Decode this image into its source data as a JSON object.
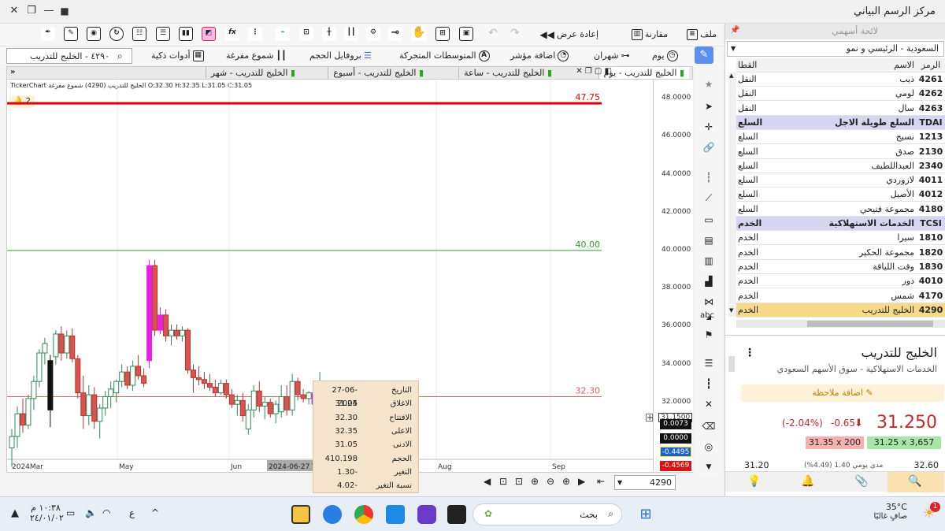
{
  "window": {
    "title": "مركز الرسم البياني"
  },
  "toolbar1": {
    "file": "ملف",
    "compare": "مقارنة",
    "replay": "إعادة عرض"
  },
  "toolbar2": {
    "search_value": "٤٢٩٠ - الخليج للتدريب",
    "smart_tools": "أدوات ذكية",
    "hollow_candles": "شموع مفرغة",
    "volume_profile": "بروفايل الحجم",
    "moving_averages": "المتوسطات المتحركة",
    "add_indicator": "اضافة مؤشر",
    "two_months": "شهران",
    "day": "يوم"
  },
  "tabs": [
    {
      "label": "الخليج للتدريب - يوم"
    },
    {
      "label": "الخليج للتدريب - ساعة"
    },
    {
      "label": "الخليج للتدريب - أسبوع"
    },
    {
      "label": "الخليج للتدريب - شهر"
    }
  ],
  "chart_header": {
    "source": "TickerChart",
    "symbol_info": "الخليج للتدريب (4290) شموع مفرغة",
    "ohlc": "O:32.30  H:32.35  L:31.05  C:31.05",
    "alerts_count": "2"
  },
  "chart_data": {
    "type": "candlestick",
    "yticks": [
      "48.0000",
      "46.0000",
      "44.0000",
      "42.0000",
      "40.0000",
      "38.0000",
      "36.0000",
      "34.0000",
      "32.0000",
      "30.0000"
    ],
    "xticks": [
      "2024Mar",
      "May",
      "Jun",
      "Aug",
      "Sep"
    ],
    "cursor_date": "2024-06-27 T",
    "levels": [
      {
        "label": "47.75",
        "value": 47.75,
        "color": "#e00000"
      },
      {
        "label": "40.00",
        "value": 40.0,
        "color": "#2ca02c"
      },
      {
        "label": "32.30",
        "value": 32.3,
        "color": "#e06060"
      }
    ],
    "last_price_label": "31.1500",
    "ylim": [
      29.0,
      49.0
    ],
    "candles": [
      {
        "o": 29.6,
        "h": 30.6,
        "l": 28.6,
        "c": 30.2,
        "col": "g"
      },
      {
        "o": 30.2,
        "h": 31.8,
        "l": 29.6,
        "c": 31.4,
        "col": "g"
      },
      {
        "o": 31.4,
        "h": 32.2,
        "l": 30.4,
        "c": 30.8,
        "col": "r"
      },
      {
        "o": 30.8,
        "h": 32.4,
        "l": 30.6,
        "c": 32.2,
        "col": "g"
      },
      {
        "o": 32.2,
        "h": 33.4,
        "l": 31.6,
        "c": 33.1,
        "col": "g"
      },
      {
        "o": 33.1,
        "h": 34.8,
        "l": 32.8,
        "c": 34.6,
        "col": "g"
      },
      {
        "o": 34.6,
        "h": 35.4,
        "l": 34.0,
        "c": 35.1,
        "col": "g"
      },
      {
        "o": 31.6,
        "h": 34.5,
        "l": 30.7,
        "c": 34.2,
        "col": "k"
      },
      {
        "o": 34.4,
        "h": 35.8,
        "l": 34.0,
        "c": 35.6,
        "col": "g"
      },
      {
        "o": 35.6,
        "h": 36.0,
        "l": 34.2,
        "c": 34.6,
        "col": "r"
      },
      {
        "o": 34.6,
        "h": 35.8,
        "l": 34.3,
        "c": 35.5,
        "col": "g"
      },
      {
        "o": 35.5,
        "h": 35.9,
        "l": 34.1,
        "c": 34.3,
        "col": "r"
      },
      {
        "o": 34.3,
        "h": 34.5,
        "l": 32.2,
        "c": 32.5,
        "col": "r"
      },
      {
        "o": 32.5,
        "h": 33.4,
        "l": 30.6,
        "c": 31.3,
        "col": "r"
      },
      {
        "o": 31.3,
        "h": 32.9,
        "l": 30.8,
        "c": 32.4,
        "col": "g"
      },
      {
        "o": 32.4,
        "h": 32.8,
        "l": 30.6,
        "c": 31.0,
        "col": "r"
      },
      {
        "o": 31.0,
        "h": 31.9,
        "l": 30.1,
        "c": 31.7,
        "col": "g"
      },
      {
        "o": 31.7,
        "h": 32.6,
        "l": 31.3,
        "c": 32.3,
        "col": "g"
      },
      {
        "o": 32.3,
        "h": 33.1,
        "l": 31.7,
        "c": 32.7,
        "col": "g"
      },
      {
        "o": 32.5,
        "h": 33.2,
        "l": 32.0,
        "c": 33.1,
        "col": "g"
      },
      {
        "o": 33.1,
        "h": 34.0,
        "l": 32.8,
        "c": 33.6,
        "col": "g"
      },
      {
        "o": 33.6,
        "h": 33.9,
        "l": 32.7,
        "c": 32.9,
        "col": "r"
      },
      {
        "o": 32.9,
        "h": 34.2,
        "l": 32.6,
        "c": 33.9,
        "col": "g"
      },
      {
        "o": 33.9,
        "h": 34.5,
        "l": 33.2,
        "c": 33.4,
        "col": "r"
      },
      {
        "o": 33.4,
        "h": 33.8,
        "l": 32.8,
        "c": 33.0,
        "col": "r"
      },
      {
        "o": 34.2,
        "h": 39.5,
        "l": 33.8,
        "c": 39.2,
        "col": "m"
      },
      {
        "o": 39.2,
        "h": 39.5,
        "l": 35.5,
        "c": 35.8,
        "col": "r"
      },
      {
        "o": 35.8,
        "h": 37.0,
        "l": 35.6,
        "c": 36.6,
        "col": "m"
      },
      {
        "o": 36.6,
        "h": 36.9,
        "l": 35.2,
        "c": 35.5,
        "col": "r"
      },
      {
        "o": 35.5,
        "h": 36.1,
        "l": 35.0,
        "c": 35.8,
        "col": "g"
      },
      {
        "o": 35.8,
        "h": 36.1,
        "l": 35.3,
        "c": 35.5,
        "col": "r"
      },
      {
        "o": 35.5,
        "h": 36.0,
        "l": 35.2,
        "c": 35.8,
        "col": "g"
      },
      {
        "o": 35.8,
        "h": 35.9,
        "l": 33.5,
        "c": 33.7,
        "col": "r"
      },
      {
        "o": 33.7,
        "h": 34.0,
        "l": 32.5,
        "c": 33.3,
        "col": "r"
      },
      {
        "o": 33.3,
        "h": 33.9,
        "l": 32.9,
        "c": 33.2,
        "col": "r"
      },
      {
        "o": 33.2,
        "h": 33.6,
        "l": 32.7,
        "c": 33.0,
        "col": "r"
      },
      {
        "o": 33.0,
        "h": 33.5,
        "l": 32.6,
        "c": 32.8,
        "col": "r"
      },
      {
        "o": 32.8,
        "h": 33.2,
        "l": 32.3,
        "c": 32.5,
        "col": "r"
      },
      {
        "o": 32.5,
        "h": 33.2,
        "l": 32.4,
        "c": 33.0,
        "col": "g"
      },
      {
        "o": 33.0,
        "h": 33.2,
        "l": 32.2,
        "c": 32.4,
        "col": "r"
      },
      {
        "o": 32.4,
        "h": 32.7,
        "l": 31.7,
        "c": 31.9,
        "col": "r"
      },
      {
        "o": 31.9,
        "h": 32.4,
        "l": 31.3,
        "c": 32.1,
        "col": "g"
      },
      {
        "o": 32.1,
        "h": 32.5,
        "l": 31.0,
        "c": 31.3,
        "col": "r"
      },
      {
        "o": 30.6,
        "h": 31.9,
        "l": 30.3,
        "c": 31.6,
        "col": "g"
      },
      {
        "o": 31.6,
        "h": 32.9,
        "l": 31.2,
        "c": 32.6,
        "col": "g"
      },
      {
        "o": 32.6,
        "h": 33.1,
        "l": 31.5,
        "c": 31.8,
        "col": "r"
      },
      {
        "o": 31.8,
        "h": 32.3,
        "l": 31.1,
        "c": 32.0,
        "col": "g"
      },
      {
        "o": 32.0,
        "h": 32.2,
        "l": 31.2,
        "c": 31.4,
        "col": "r"
      },
      {
        "o": 31.4,
        "h": 32.1,
        "l": 30.9,
        "c": 31.9,
        "col": "g"
      },
      {
        "o": 31.5,
        "h": 32.9,
        "l": 31.2,
        "c": 32.3,
        "col": "g"
      },
      {
        "o": 32.3,
        "h": 32.9,
        "l": 31.3,
        "c": 31.6,
        "col": "r"
      },
      {
        "o": 31.6,
        "h": 33.5,
        "l": 31.3,
        "c": 33.1,
        "col": "g"
      },
      {
        "o": 33.1,
        "h": 33.3,
        "l": 32.1,
        "c": 32.4,
        "col": "r"
      },
      {
        "o": 32.4,
        "h": 32.7,
        "l": 32.0,
        "c": 32.2,
        "col": "r"
      },
      {
        "o": 32.2,
        "h": 32.6,
        "l": 31.9,
        "c": 32.5,
        "col": "g"
      },
      {
        "o": 32.5,
        "h": 32.6,
        "l": 31.6,
        "c": 31.9,
        "col": "m"
      },
      {
        "o": 31.9,
        "h": 33.6,
        "l": 31.6,
        "c": 32.2,
        "col": "g"
      },
      {
        "o": 32.2,
        "h": 32.4,
        "l": 30.7,
        "c": 31.0,
        "col": "r"
      },
      {
        "o": 31.0,
        "h": 31.6,
        "l": 30.6,
        "c": 31.4,
        "col": "g"
      },
      {
        "o": 31.4,
        "h": 32.5,
        "l": 31.1,
        "c": 32.2,
        "col": "g"
      },
      {
        "o": 32.2,
        "h": 32.6,
        "l": 31.0,
        "c": 31.1,
        "col": "r"
      }
    ]
  },
  "tooltip": {
    "rows": [
      {
        "label": "التاريخ",
        "value": "27-06-2024"
      },
      {
        "label": "الاغلاق",
        "value": "31.05"
      },
      {
        "label": "الافتتاح",
        "value": "32.30"
      },
      {
        "label": "الاعلى",
        "value": "32.35"
      },
      {
        "label": "الادنى",
        "value": "31.05"
      },
      {
        "label": "الحجم",
        "value": "410.198"
      },
      {
        "label": "التغير",
        "value": "1.30-"
      },
      {
        "label": "نسبة التغير",
        "value": "4.02-"
      }
    ]
  },
  "indicator_values": [
    "0.0073",
    "0.0000",
    "-0.4495",
    "-0.4569"
  ],
  "bottom_bar": {
    "symbol": "4290"
  },
  "watchlist": {
    "title": "لائحة أسهمي",
    "market": "السعودية - الرئيسي و نمو",
    "headers": {
      "symbol": "الرمز",
      "name": "الاسم",
      "sector": "القطا"
    },
    "rows": [
      {
        "symbol": "4261",
        "name": "ذيب",
        "sector": "النقل",
        "kind": "row"
      },
      {
        "symbol": "4262",
        "name": "لومي",
        "sector": "النقل",
        "kind": "row"
      },
      {
        "symbol": "4263",
        "name": "سال",
        "sector": "النقل",
        "kind": "row"
      },
      {
        "symbol": "TDAI",
        "name": "السلع طويلة الاجل",
        "sector": "السلع",
        "kind": "group"
      },
      {
        "symbol": "1213",
        "name": "نسيج",
        "sector": "السلع",
        "kind": "row"
      },
      {
        "symbol": "2130",
        "name": "صدق",
        "sector": "السلع",
        "kind": "row"
      },
      {
        "symbol": "2340",
        "name": "العبداللطيف",
        "sector": "السلع",
        "kind": "row"
      },
      {
        "symbol": "4011",
        "name": "لازوردي",
        "sector": "السلع",
        "kind": "row"
      },
      {
        "symbol": "4012",
        "name": "الأصيل",
        "sector": "السلع",
        "kind": "row"
      },
      {
        "symbol": "4180",
        "name": "مجموعة فتيحي",
        "sector": "السلع",
        "kind": "row"
      },
      {
        "symbol": "TCSI",
        "name": "الخدمات الاستهلاكية",
        "sector": "الخدم",
        "kind": "group"
      },
      {
        "symbol": "1810",
        "name": "سيرا",
        "sector": "الخدم",
        "kind": "row"
      },
      {
        "symbol": "1820",
        "name": "مجموعة الحكير",
        "sector": "الخدم",
        "kind": "row"
      },
      {
        "symbol": "1830",
        "name": "وقت اللياقة",
        "sector": "الخدم",
        "kind": "row"
      },
      {
        "symbol": "4010",
        "name": "دور",
        "sector": "الخدم",
        "kind": "row"
      },
      {
        "symbol": "4170",
        "name": "شمس",
        "sector": "الخدم",
        "kind": "row"
      },
      {
        "symbol": "4290",
        "name": "الخليج للتدريب",
        "sector": "الخدم",
        "kind": "sel"
      }
    ]
  },
  "info_panel": {
    "company": "الخليج للتدريب",
    "sector_market": "الخدمات الاستهلاكية - سوق الأسهم السعودي",
    "add_note": "اضافة ملاحظة",
    "price": "31.250",
    "change": "-0.65",
    "change_pct": "(-2.04%)",
    "ask": "31.35 x 200",
    "bid": "31.25 x 3,657",
    "range_label": "مدى يومي 1.40 (4.49%)",
    "range_low": "31.20",
    "range_high": "32.60"
  },
  "taskbar": {
    "search": "بحث",
    "time": "١٠:٣٨ م",
    "date": "٢٤/٠١/٠٢",
    "lang": "ع",
    "weather_temp": "35°C",
    "weather_desc": "صافٍ غالبًا",
    "notif": "1"
  },
  "colors": {
    "up": "#2e8b57",
    "down": "#d9534f",
    "highlight": "#e91ee5",
    "group_bg": "#d7d5ef",
    "selected_bg": "#f8d98a"
  }
}
